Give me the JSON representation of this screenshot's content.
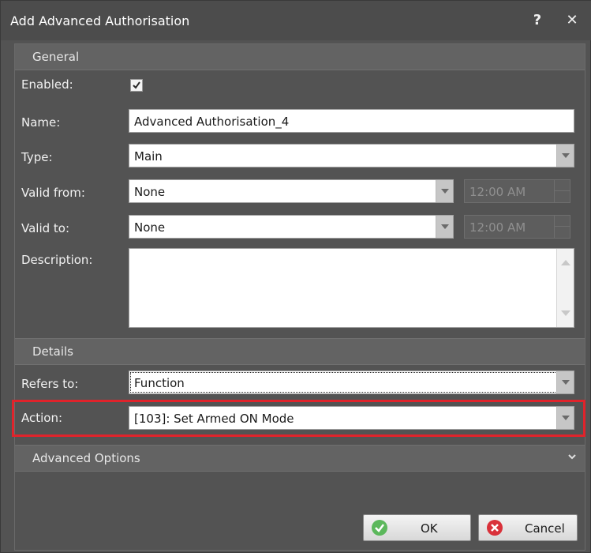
{
  "window": {
    "title": "Add Advanced Authorisation",
    "help_glyph": "?",
    "close_glyph": "✕"
  },
  "general": {
    "header": "General",
    "enabled_label": "Enabled:",
    "enabled_checked": true,
    "name_label": "Name:",
    "name_value": "Advanced Authorisation_4",
    "type_label": "Type:",
    "type_value": "Main",
    "valid_from_label": "Valid from:",
    "valid_from_value": "None",
    "valid_from_time": "12:00 AM",
    "valid_to_label": "Valid to:",
    "valid_to_value": "None",
    "valid_to_time": "12:00 AM",
    "description_label": "Description:",
    "description_value": ""
  },
  "details": {
    "header": "Details",
    "refers_to_label": "Refers to:",
    "refers_to_value": "Function",
    "action_label": "Action:",
    "action_value": "[103]: Set Armed ON Mode"
  },
  "advanced_options": {
    "label": "Advanced Options"
  },
  "buttons": {
    "ok_label": "OK",
    "cancel_label": "Cancel"
  },
  "colors": {
    "highlight": "#e0232b",
    "ok_icon": "#5cb85c",
    "cancel_icon": "#d9313a"
  }
}
